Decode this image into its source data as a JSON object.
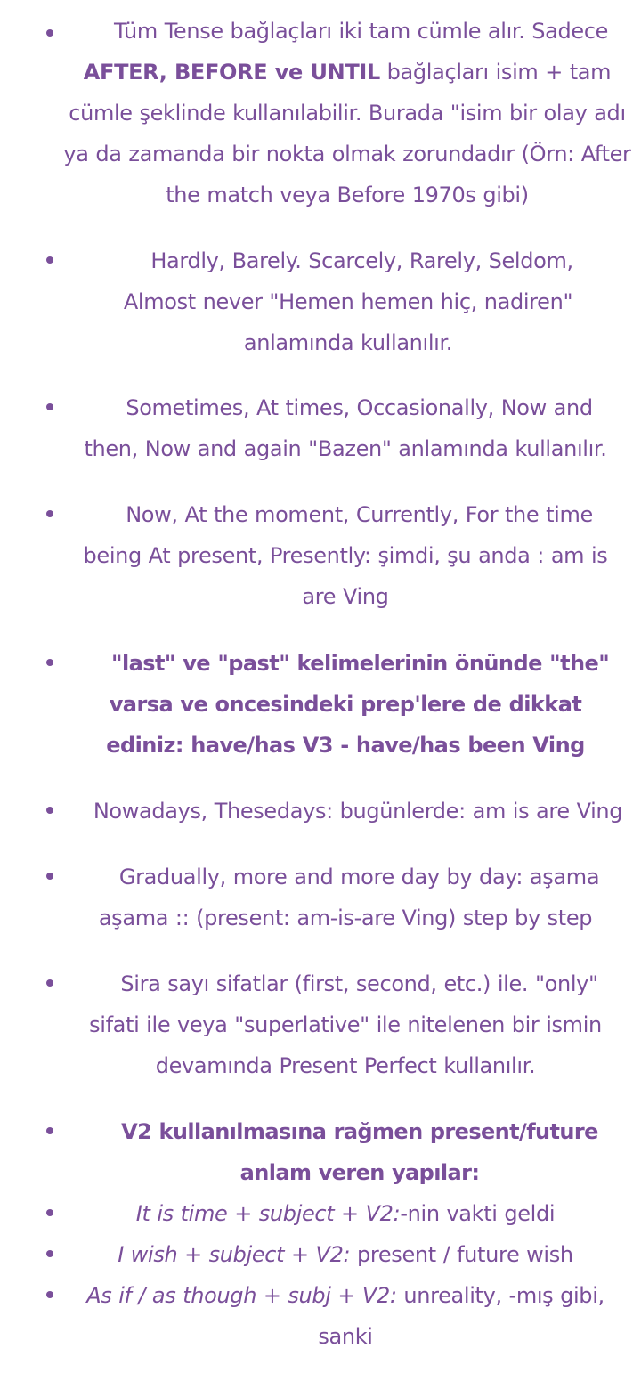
{
  "items": [
    {
      "id": "tense-conjunctions",
      "text_a": "Tüm Tense bağlaçları iki tam cümle alır. Sadece ",
      "bold": "AFTER, BEFORE ve UNTIL",
      "text_b": " bağlaçları isim + tam cümle şeklinde kullanılabilir. Burada \"isim bir olay adı ya da zamanda bir nokta olmak zorundadır (Örn: After the match veya Before 1970s gibi)"
    },
    {
      "id": "hardly",
      "text": "Hardly, Barely. Scarcely, Rarely, Seldom, Almost never \"Hemen hemen hiç, nadiren\" anlamında kullanılır."
    },
    {
      "id": "sometimes",
      "text": "Sometimes, At times, Occasionally, Now and then, Now and again \"Bazen\" anlamında kullanılır."
    },
    {
      "id": "now",
      "text": "Now, At the moment, Currently, For the time being At present, Presently: şimdi, şu anda : am is are Ving"
    },
    {
      "id": "last-past",
      "text": "\"last\" ve \"past\" kelimelerinin önünde \"the\" varsa ve oncesindeki prep'lere de dikkat ediniz: have/has V3 - have/has been Ving"
    },
    {
      "id": "nowadays",
      "text": "Nowadays, Thesedays: bugünlerde: am is are Ving"
    },
    {
      "id": "gradually",
      "text": "Gradually, more and more day by day: aşama aşama :: (present: am-is-are Ving) step by step"
    },
    {
      "id": "ordinal",
      "text": "Sira sayı sifatlar (first, second, etc.) ile. \"only\" sifati ile veya \"superlative\" ile nitelenen bir ismin devamında Present Perfect kullanılır."
    },
    {
      "id": "v2-heading",
      "text": "V2 kullanılmasına rağmen present/future anlam veren yapılar:"
    },
    {
      "id": "time",
      "italic": "It is time + subject + V2:",
      "text": "-nin vakti geldi"
    },
    {
      "id": "wish",
      "italic": "I wish + subject + V2:",
      "text": " present / future wish"
    },
    {
      "id": "as-if",
      "italic": "As if / as though + subj + V2:",
      "text": " unreality, -mış gibi, sanki"
    }
  ]
}
